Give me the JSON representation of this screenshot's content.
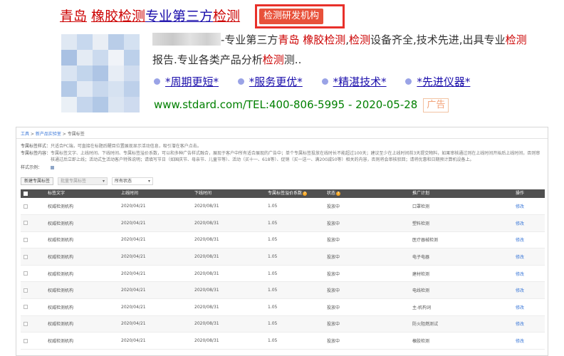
{
  "ad": {
    "title_kw1": "青岛",
    "title_kw2": "橡胶检测",
    "title_mid": "专业第三方",
    "title_kw3": "检测",
    "tag": "检测研发机构",
    "desc_p1": "-专业第三方",
    "desc_kw1": "青岛",
    "desc_kw2": "橡胶检测",
    "desc_p2": ",",
    "desc_kw3": "检测",
    "desc_p3": "设备齐全,技术先进,出具专业",
    "desc_kw4": "检测",
    "desc_p4": "报告.专业各类产品分析",
    "desc_kw5": "检测",
    "desc_p5": "测..",
    "links": [
      "*周期更短*",
      "*服务更优*",
      "*精湛技术*",
      "*先进仪器*"
    ],
    "url": "www.stdard.com/TEL:400-806-5995 - 2020-05-28",
    "badge": "广告"
  },
  "panel": {
    "breadcrumb": [
      "工具",
      "新产品实验室",
      "专属标签"
    ],
    "desc_label1": "专属标签样式：",
    "desc_text1": "只适合PC端，可直接在标题后醒目位置展现显示活动信息，吸引潜在客户点击。",
    "desc_label2": "专属标签内容：",
    "desc_text2": "专属标签文字、上线时间、下线时间、专属标签溢价系数，可以和多种广告样式融合，展现于客户中所有适合展现的广告中；单个专属标签投放在线时长不能超过100天；建议至少在上线时间前3天提交物料，如果审核通过则在上线时间开始后上线时间，否则审核通过后立即上线；活动式生活动客户特殊说明；请填写节日（如国庆节、母亲节、儿童节等）、活动（买十一、618等）、促销（买一送一、满200减50等）相关的内容，否则将会审核驳回；请将优惠和日期预计算机设备上。",
    "desc_label3": "样式示例：",
    "btn_new": "新建专属标签",
    "select_batch": "批量专属标签",
    "select_status": "所有状态",
    "columns": [
      "",
      "标签文字",
      "上线时间",
      "下线时间",
      "专属标签溢价系数",
      "状态",
      "推广计划",
      "操作"
    ],
    "rows": [
      {
        "text": "权威检测机构",
        "on": "2020/04/21",
        "off": "2020/08/31",
        "coef": "1.05",
        "status": "投放中",
        "plan": "口罩检测",
        "op": "修改"
      },
      {
        "text": "权威检测机构",
        "on": "2020/04/21",
        "off": "2020/08/31",
        "coef": "1.05",
        "status": "投放中",
        "plan": "塑料检测",
        "op": "修改"
      },
      {
        "text": "权威检测机构",
        "on": "2020/04/21",
        "off": "2020/08/31",
        "coef": "1.05",
        "status": "投放中",
        "plan": "医疗器械检测",
        "op": "修改"
      },
      {
        "text": "权威检测机构",
        "on": "2020/04/21",
        "off": "2020/08/31",
        "coef": "1.05",
        "status": "投放中",
        "plan": "电子电器",
        "op": "修改"
      },
      {
        "text": "权威检测机构",
        "on": "2020/04/21",
        "off": "2020/08/31",
        "coef": "1.05",
        "status": "投放中",
        "plan": "建材检测",
        "op": "修改"
      },
      {
        "text": "权威检测机构",
        "on": "2020/04/21",
        "off": "2020/08/31",
        "coef": "1.05",
        "status": "投放中",
        "plan": "电线检测",
        "op": "修改"
      },
      {
        "text": "权威检测机构",
        "on": "2020/04/21",
        "off": "2020/08/31",
        "coef": "1.05",
        "status": "投放中",
        "plan": "主-机构词",
        "op": "修改"
      },
      {
        "text": "权威检测机构",
        "on": "2020/04/21",
        "off": "2020/08/31",
        "coef": "1.05",
        "status": "投放中",
        "plan": "防火阻燃测试",
        "op": "修改"
      },
      {
        "text": "权威检测机构",
        "on": "2020/04/21",
        "off": "2020/08/31",
        "coef": "1.05",
        "status": "投放中",
        "plan": "橡胶检测",
        "op": "修改"
      }
    ]
  },
  "colors": {
    "link": "#1a0dab",
    "keyword": "#cc0000",
    "url": "#008000",
    "tag_bg": "#e8513a",
    "header_bg": "#505050"
  }
}
